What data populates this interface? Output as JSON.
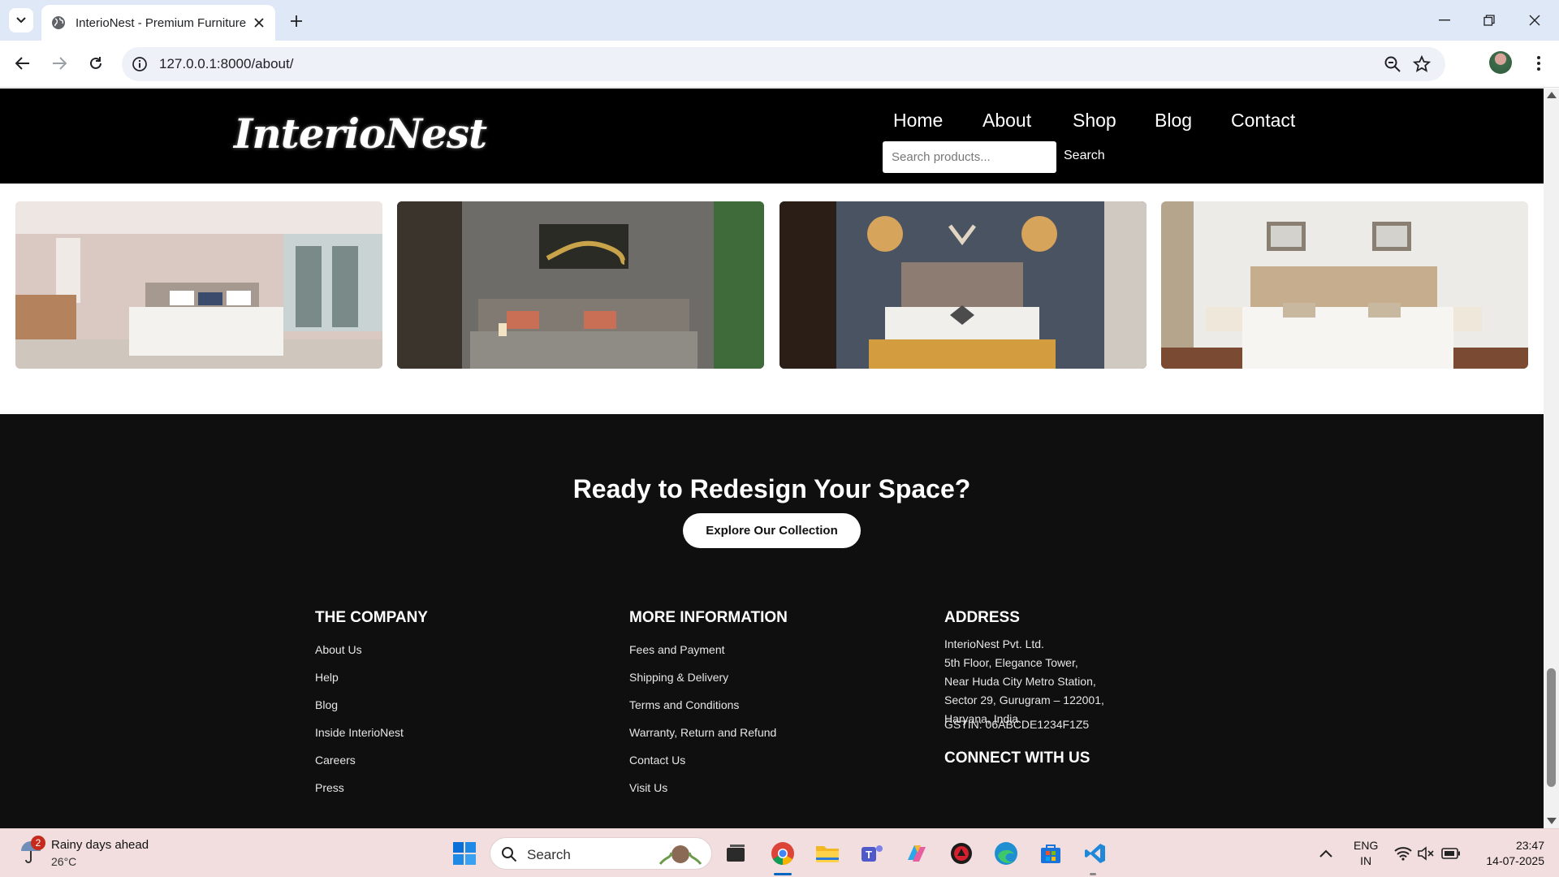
{
  "browser": {
    "tab_title": "InterioNest - Premium Furniture",
    "url": "127.0.0.1:8000/about/"
  },
  "site": {
    "logo": "InterioNest",
    "nav": [
      "Home",
      "About",
      "Shop",
      "Blog",
      "Contact"
    ],
    "search_placeholder": "Search products...",
    "search_button": "Search"
  },
  "gallery": {
    "images": [
      "bedroom-image-1",
      "bedroom-image-2",
      "bedroom-image-3",
      "bedroom-image-4"
    ]
  },
  "cta": {
    "title": "Ready to Redesign Your Space?",
    "button": "Explore Our Collection"
  },
  "footer": {
    "company": {
      "heading": "THE COMPANY",
      "links": [
        "About Us",
        "Help",
        "Blog",
        "Inside InterioNest",
        "Careers",
        "Press"
      ]
    },
    "info": {
      "heading": "MORE INFORMATION",
      "links": [
        "Fees and Payment",
        "Shipping & Delivery",
        "Terms and Conditions",
        "Warranty, Return and Refund",
        "Contact Us",
        "Visit Us"
      ]
    },
    "address": {
      "heading": "ADDRESS",
      "lines": [
        "InterioNest Pvt. Ltd.",
        "5th Floor, Elegance Tower,",
        "Near Huda City Metro Station,",
        "Sector 29, Gurugram – 122001,",
        "Haryana, India"
      ],
      "gstin": "GSTIN: 06ABCDE1234F1Z5",
      "connect_heading": "CONNECT WITH US"
    }
  },
  "taskbar": {
    "weather_badge": "2",
    "weather_text": "Rainy days ahead",
    "weather_temp": "26°C",
    "search_label": "Search",
    "lang_1": "ENG",
    "lang_2": "IN",
    "time": "23:47",
    "date": "14-07-2025"
  }
}
